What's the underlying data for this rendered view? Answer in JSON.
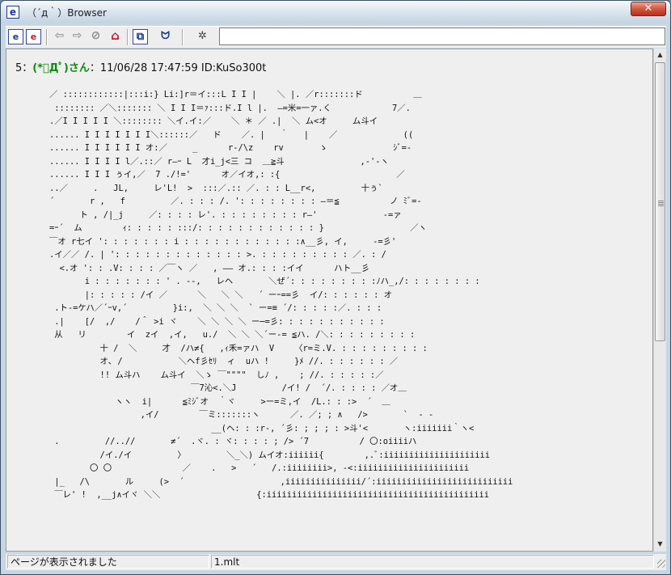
{
  "window": {
    "title": "（´д｀）Browser",
    "app_icon": "e",
    "close_glyph": "✕"
  },
  "toolbar": {
    "buttons": [
      {
        "name": "home-e-icon",
        "glyph": "e"
      },
      {
        "name": "page-e-icon",
        "glyph": "e"
      },
      {
        "name": "back-icon",
        "glyph": "⇦"
      },
      {
        "name": "forward-icon",
        "glyph": "⇨"
      },
      {
        "name": "stop-icon",
        "glyph": "⊘"
      },
      {
        "name": "home-icon",
        "glyph": "⌂"
      },
      {
        "name": "windows-icon",
        "glyph": "⧉"
      },
      {
        "name": "mona-icon",
        "glyph": "ᗢ"
      },
      {
        "name": "settings-face-icon",
        "glyph": "✲"
      }
    ],
    "url_value": ""
  },
  "post": {
    "number": "5",
    "separator": "：",
    "name": "(*ﾟДﾟ)さん",
    "date": "：11/06/28 17:47:59 ID:KuSo300t",
    "aa_lines": [
      "／ ::::::::::::|:::i:} Li:]r＝イ:::L I I |    ＼ |. ／r:::::::ド          ＿",
      " :::::::: ／＼::::::: ＼ I I I＝ｧ:::ド.I l |.  ―=米=一ァ.く            7／.",
      ".／I I I I I ＼:::::::: ＼イ.イ:／    ＼ ＊ ／ .|  ＼ ム<オ     ム斗イ",
      "...... I I I I I I I＼::::::／   ド    ／. |   ｀   |    ／             ((",
      "...... I I I I I I オ:／     _      r-/\\z    rv       ゝ             ｼﾞ=-",
      "...... I I I I l／.::／ r―ｰ L  才i_j<三 コ  ＿≧斗               ,‐'‐ヽ",
      "...... I I I ぅイ,／  7 ./!='      オ／イオ,: :{                       ／",
      "..／     .   JL,     レ'L!  >  :::／.:: ／. : : L__r<,         十ぅ`",
      "´       r ,   f         ／. : : : /. ': : : : : : : : ―＝≦          ノ ﾐﾞ=-",
      "      ト , /|_j     ／: : : : レ'. : : : : : : : : r―'             -=ァ",
      "=ｰ´  ム        ｨ: : : : : :::/: : : : : : : : : : : : }                 ／ヽ",
      "￣オ r七イ ': : : : : : : i : : : : : : : : : : : :∧__彡, イ,     -=彡'",
      ".イ／／ /. | ': : : : : : : : : : : : : >. : : : : : : : : : ／. : /",
      "  <.オ ': : .V: : : : ／￣ヽ ／   , ―― オ.: : : :イイ      ハト__彡",
      "       i : : : : : : : ' . --,   レヘ       ＼ぜ´: : : : : : : : :ﾉハ_,/: : : : : : : :",
      "       |: : : : : /イ ／      ＼   ＼ ＼   ´ ーｰ==彡  イ/: : : : : : オ",
      " .ト-=ケハ／´ｰv,´         }i:,  ＼ ＼ ＼  ` ー=≡ ´/: : : : :／. : : :",
      " .|    [/  ,/    /＾ >i ヾ    ＼ ＼ ＼ ＼ ー─=彡: : : : : : : : : : :",
      " 从   リ        イ  zイ  ,イ,   u./  ＼ ＼ ＼´ー-= ≦ハ. /＼: : : : : : : : :",
      "          十 /  ＼     才  /ハ≠{   ,ｨ禾=ァハ  V    〈r=ミ.V. : : : : : : : : :",
      "          オ､ /           ＼ヘf彡ｾﾘ  ィ  uハ !     }ﾒ //. : : : : : : ／",
      "          !! ム斗ハ    ム斗イ  ＼ゝ ￣\"\"\"\"  しﾉ ,    ; //. : : : : :／",
      "                            ￣7沁<.＼J         /イ! /  ´/. : : : : ／オ＿",
      "             ヽヽ  i|      ≦ﾐｼﾞオ  ｀ヾ     >ー=ミ,イ  /L.: : :>  ´  ＿",
      "                  ,イ/        ￣ミ:::::::ヽ      ／. ／; ; ∧   />       `  - -",
      "                                __(ヘ: : :r-, ´彡: ; ; ; : >斗'<       ヽ:iiiiiii｀ヽ<",
      " .         //..//       ≠´  .ヾ. : ヾ: : : : ; /> ´7          / 〇:oiiiiハ",
      "          /イ./イ         〉        ＼_＼) ムイオ:iiiiii{        ,.ﾞ:iiiiiiiiiiiiiiiiiiiii",
      "        〇 〇              ／    .   >   ´   /.:iiiiiiii>, -<:iiiiiiiiiiiiiiiiiiiiii",
      " |_   /\\       ル     (>  ´                   ,iiiiiiiiiiiiiii/´:iiiiiiiiiiiiiiiiiiiiiiiiiii",
      " ￣レ' !  ,__j∧イヾ ＼＼                   {:iiiiiiiiiiiiiiiiiiiiiiiiiiiiiiiiiiiiiiiiiiii"
    ]
  },
  "statusbar": {
    "message": "ページが表示されました",
    "file": "1.mlt"
  }
}
